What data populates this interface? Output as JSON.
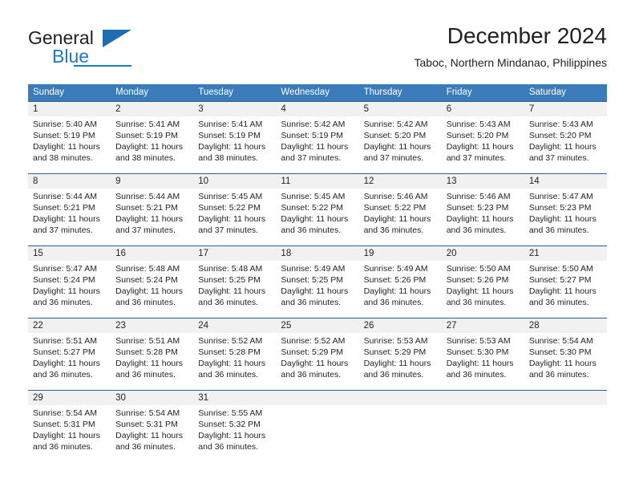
{
  "brand": {
    "name_part1": "General",
    "name_part2": "Blue",
    "accent_color": "#1f7ac1",
    "triangle_color": "#1f6cb0"
  },
  "header": {
    "title": "December 2024",
    "subtitle": "Taboc, Northern Mindanao, Philippines"
  },
  "calendar": {
    "header_bg": "#3a7cba",
    "daynum_bg": "#f1f1f1",
    "weekdays": [
      "Sunday",
      "Monday",
      "Tuesday",
      "Wednesday",
      "Thursday",
      "Friday",
      "Saturday"
    ],
    "weeks": [
      [
        {
          "day": "1",
          "sunrise": "Sunrise: 5:40 AM",
          "sunset": "Sunset: 5:19 PM",
          "daylight_1": "Daylight: 11 hours",
          "daylight_2": "and 38 minutes."
        },
        {
          "day": "2",
          "sunrise": "Sunrise: 5:41 AM",
          "sunset": "Sunset: 5:19 PM",
          "daylight_1": "Daylight: 11 hours",
          "daylight_2": "and 38 minutes."
        },
        {
          "day": "3",
          "sunrise": "Sunrise: 5:41 AM",
          "sunset": "Sunset: 5:19 PM",
          "daylight_1": "Daylight: 11 hours",
          "daylight_2": "and 38 minutes."
        },
        {
          "day": "4",
          "sunrise": "Sunrise: 5:42 AM",
          "sunset": "Sunset: 5:19 PM",
          "daylight_1": "Daylight: 11 hours",
          "daylight_2": "and 37 minutes."
        },
        {
          "day": "5",
          "sunrise": "Sunrise: 5:42 AM",
          "sunset": "Sunset: 5:20 PM",
          "daylight_1": "Daylight: 11 hours",
          "daylight_2": "and 37 minutes."
        },
        {
          "day": "6",
          "sunrise": "Sunrise: 5:43 AM",
          "sunset": "Sunset: 5:20 PM",
          "daylight_1": "Daylight: 11 hours",
          "daylight_2": "and 37 minutes."
        },
        {
          "day": "7",
          "sunrise": "Sunrise: 5:43 AM",
          "sunset": "Sunset: 5:20 PM",
          "daylight_1": "Daylight: 11 hours",
          "daylight_2": "and 37 minutes."
        }
      ],
      [
        {
          "day": "8",
          "sunrise": "Sunrise: 5:44 AM",
          "sunset": "Sunset: 5:21 PM",
          "daylight_1": "Daylight: 11 hours",
          "daylight_2": "and 37 minutes."
        },
        {
          "day": "9",
          "sunrise": "Sunrise: 5:44 AM",
          "sunset": "Sunset: 5:21 PM",
          "daylight_1": "Daylight: 11 hours",
          "daylight_2": "and 37 minutes."
        },
        {
          "day": "10",
          "sunrise": "Sunrise: 5:45 AM",
          "sunset": "Sunset: 5:22 PM",
          "daylight_1": "Daylight: 11 hours",
          "daylight_2": "and 37 minutes."
        },
        {
          "day": "11",
          "sunrise": "Sunrise: 5:45 AM",
          "sunset": "Sunset: 5:22 PM",
          "daylight_1": "Daylight: 11 hours",
          "daylight_2": "and 36 minutes."
        },
        {
          "day": "12",
          "sunrise": "Sunrise: 5:46 AM",
          "sunset": "Sunset: 5:22 PM",
          "daylight_1": "Daylight: 11 hours",
          "daylight_2": "and 36 minutes."
        },
        {
          "day": "13",
          "sunrise": "Sunrise: 5:46 AM",
          "sunset": "Sunset: 5:23 PM",
          "daylight_1": "Daylight: 11 hours",
          "daylight_2": "and 36 minutes."
        },
        {
          "day": "14",
          "sunrise": "Sunrise: 5:47 AM",
          "sunset": "Sunset: 5:23 PM",
          "daylight_1": "Daylight: 11 hours",
          "daylight_2": "and 36 minutes."
        }
      ],
      [
        {
          "day": "15",
          "sunrise": "Sunrise: 5:47 AM",
          "sunset": "Sunset: 5:24 PM",
          "daylight_1": "Daylight: 11 hours",
          "daylight_2": "and 36 minutes."
        },
        {
          "day": "16",
          "sunrise": "Sunrise: 5:48 AM",
          "sunset": "Sunset: 5:24 PM",
          "daylight_1": "Daylight: 11 hours",
          "daylight_2": "and 36 minutes."
        },
        {
          "day": "17",
          "sunrise": "Sunrise: 5:48 AM",
          "sunset": "Sunset: 5:25 PM",
          "daylight_1": "Daylight: 11 hours",
          "daylight_2": "and 36 minutes."
        },
        {
          "day": "18",
          "sunrise": "Sunrise: 5:49 AM",
          "sunset": "Sunset: 5:25 PM",
          "daylight_1": "Daylight: 11 hours",
          "daylight_2": "and 36 minutes."
        },
        {
          "day": "19",
          "sunrise": "Sunrise: 5:49 AM",
          "sunset": "Sunset: 5:26 PM",
          "daylight_1": "Daylight: 11 hours",
          "daylight_2": "and 36 minutes."
        },
        {
          "day": "20",
          "sunrise": "Sunrise: 5:50 AM",
          "sunset": "Sunset: 5:26 PM",
          "daylight_1": "Daylight: 11 hours",
          "daylight_2": "and 36 minutes."
        },
        {
          "day": "21",
          "sunrise": "Sunrise: 5:50 AM",
          "sunset": "Sunset: 5:27 PM",
          "daylight_1": "Daylight: 11 hours",
          "daylight_2": "and 36 minutes."
        }
      ],
      [
        {
          "day": "22",
          "sunrise": "Sunrise: 5:51 AM",
          "sunset": "Sunset: 5:27 PM",
          "daylight_1": "Daylight: 11 hours",
          "daylight_2": "and 36 minutes."
        },
        {
          "day": "23",
          "sunrise": "Sunrise: 5:51 AM",
          "sunset": "Sunset: 5:28 PM",
          "daylight_1": "Daylight: 11 hours",
          "daylight_2": "and 36 minutes."
        },
        {
          "day": "24",
          "sunrise": "Sunrise: 5:52 AM",
          "sunset": "Sunset: 5:28 PM",
          "daylight_1": "Daylight: 11 hours",
          "daylight_2": "and 36 minutes."
        },
        {
          "day": "25",
          "sunrise": "Sunrise: 5:52 AM",
          "sunset": "Sunset: 5:29 PM",
          "daylight_1": "Daylight: 11 hours",
          "daylight_2": "and 36 minutes."
        },
        {
          "day": "26",
          "sunrise": "Sunrise: 5:53 AM",
          "sunset": "Sunset: 5:29 PM",
          "daylight_1": "Daylight: 11 hours",
          "daylight_2": "and 36 minutes."
        },
        {
          "day": "27",
          "sunrise": "Sunrise: 5:53 AM",
          "sunset": "Sunset: 5:30 PM",
          "daylight_1": "Daylight: 11 hours",
          "daylight_2": "and 36 minutes."
        },
        {
          "day": "28",
          "sunrise": "Sunrise: 5:54 AM",
          "sunset": "Sunset: 5:30 PM",
          "daylight_1": "Daylight: 11 hours",
          "daylight_2": "and 36 minutes."
        }
      ],
      [
        {
          "day": "29",
          "sunrise": "Sunrise: 5:54 AM",
          "sunset": "Sunset: 5:31 PM",
          "daylight_1": "Daylight: 11 hours",
          "daylight_2": "and 36 minutes."
        },
        {
          "day": "30",
          "sunrise": "Sunrise: 5:54 AM",
          "sunset": "Sunset: 5:31 PM",
          "daylight_1": "Daylight: 11 hours",
          "daylight_2": "and 36 minutes."
        },
        {
          "day": "31",
          "sunrise": "Sunrise: 5:55 AM",
          "sunset": "Sunset: 5:32 PM",
          "daylight_1": "Daylight: 11 hours",
          "daylight_2": "and 36 minutes."
        },
        {
          "day": "",
          "sunrise": "",
          "sunset": "",
          "daylight_1": "",
          "daylight_2": ""
        },
        {
          "day": "",
          "sunrise": "",
          "sunset": "",
          "daylight_1": "",
          "daylight_2": ""
        },
        {
          "day": "",
          "sunrise": "",
          "sunset": "",
          "daylight_1": "",
          "daylight_2": ""
        },
        {
          "day": "",
          "sunrise": "",
          "sunset": "",
          "daylight_1": "",
          "daylight_2": ""
        }
      ]
    ]
  }
}
